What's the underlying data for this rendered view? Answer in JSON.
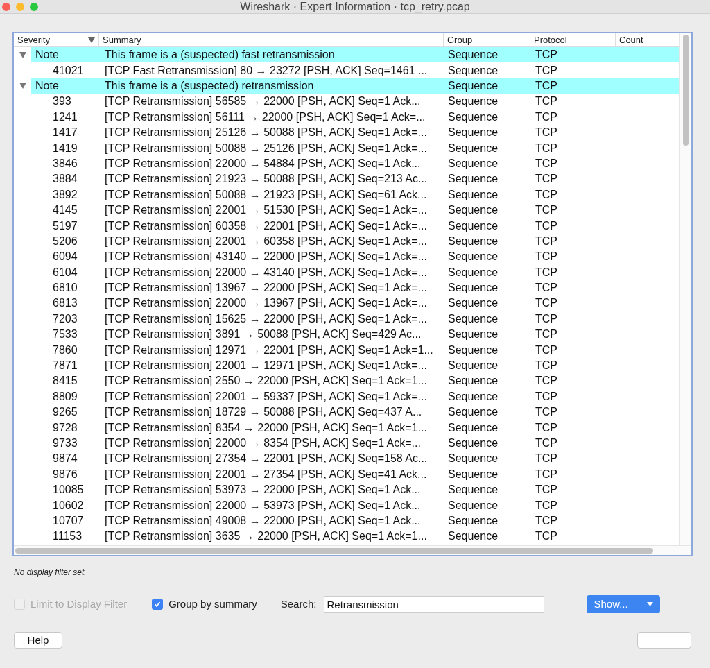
{
  "window": {
    "title": "Wireshark · Expert Information · tcp_retry.pcap"
  },
  "table": {
    "columns": [
      {
        "label": "Severity",
        "sorted": true
      },
      {
        "label": "Summary",
        "sorted": false
      },
      {
        "label": "Group",
        "sorted": false
      },
      {
        "label": "Protocol",
        "sorted": false
      },
      {
        "label": "Count",
        "sorted": false
      }
    ],
    "groups": [
      {
        "severity": "Note",
        "summary": "This frame is a (suspected) fast retransmission",
        "group": "Sequence",
        "protocol": "TCP",
        "expanded": true,
        "children": [
          {
            "packet": "41021",
            "summary": "[TCP Fast Retransmission] 80 → 23272 [PSH, ACK] Seq=1461 ...",
            "group": "Sequence",
            "protocol": "TCP"
          }
        ]
      },
      {
        "severity": "Note",
        "summary": "This frame is a (suspected) retransmission",
        "group": "Sequence",
        "protocol": "TCP",
        "expanded": true,
        "children": [
          {
            "packet": "393",
            "summary": "[TCP Retransmission] 56585 → 22000 [PSH, ACK] Seq=1 Ack...",
            "group": "Sequence",
            "protocol": "TCP"
          },
          {
            "packet": "1241",
            "summary": "[TCP Retransmission] 56111 → 22000 [PSH, ACK] Seq=1 Ack=...",
            "group": "Sequence",
            "protocol": "TCP"
          },
          {
            "packet": "1417",
            "summary": "[TCP Retransmission] 25126 → 50088 [PSH, ACK] Seq=1 Ack=...",
            "group": "Sequence",
            "protocol": "TCP"
          },
          {
            "packet": "1419",
            "summary": "[TCP Retransmission] 50088 → 25126 [PSH, ACK] Seq=1 Ack=...",
            "group": "Sequence",
            "protocol": "TCP"
          },
          {
            "packet": "3846",
            "summary": "[TCP Retransmission] 22000 → 54884 [PSH, ACK] Seq=1 Ack...",
            "group": "Sequence",
            "protocol": "TCP"
          },
          {
            "packet": "3884",
            "summary": "[TCP Retransmission] 21923 → 50088 [PSH, ACK] Seq=213 Ac...",
            "group": "Sequence",
            "protocol": "TCP"
          },
          {
            "packet": "3892",
            "summary": "[TCP Retransmission] 50088 → 21923 [PSH, ACK] Seq=61 Ack...",
            "group": "Sequence",
            "protocol": "TCP"
          },
          {
            "packet": "4145",
            "summary": "[TCP Retransmission] 22001 → 51530 [PSH, ACK] Seq=1 Ack=...",
            "group": "Sequence",
            "protocol": "TCP"
          },
          {
            "packet": "5197",
            "summary": "[TCP Retransmission] 60358 → 22001 [PSH, ACK] Seq=1 Ack=...",
            "group": "Sequence",
            "protocol": "TCP"
          },
          {
            "packet": "5206",
            "summary": "[TCP Retransmission] 22001 → 60358 [PSH, ACK] Seq=1 Ack=...",
            "group": "Sequence",
            "protocol": "TCP"
          },
          {
            "packet": "6094",
            "summary": "[TCP Retransmission] 43140 → 22000 [PSH, ACK] Seq=1 Ack=...",
            "group": "Sequence",
            "protocol": "TCP"
          },
          {
            "packet": "6104",
            "summary": "[TCP Retransmission] 22000 → 43140 [PSH, ACK] Seq=1 Ack=...",
            "group": "Sequence",
            "protocol": "TCP"
          },
          {
            "packet": "6810",
            "summary": "[TCP Retransmission] 13967 → 22000 [PSH, ACK] Seq=1 Ack=...",
            "group": "Sequence",
            "protocol": "TCP"
          },
          {
            "packet": "6813",
            "summary": "[TCP Retransmission] 22000 → 13967 [PSH, ACK] Seq=1 Ack=...",
            "group": "Sequence",
            "protocol": "TCP"
          },
          {
            "packet": "7203",
            "summary": "[TCP Retransmission] 15625 → 22000 [PSH, ACK] Seq=1 Ack=...",
            "group": "Sequence",
            "protocol": "TCP"
          },
          {
            "packet": "7533",
            "summary": "[TCP Retransmission] 3891 → 50088 [PSH, ACK] Seq=429 Ac...",
            "group": "Sequence",
            "protocol": "TCP"
          },
          {
            "packet": "7860",
            "summary": "[TCP Retransmission] 12971 → 22001 [PSH, ACK] Seq=1 Ack=1...",
            "group": "Sequence",
            "protocol": "TCP"
          },
          {
            "packet": "7871",
            "summary": "[TCP Retransmission] 22001 → 12971 [PSH, ACK] Seq=1 Ack=...",
            "group": "Sequence",
            "protocol": "TCP"
          },
          {
            "packet": "8415",
            "summary": "[TCP Retransmission] 2550 → 22000 [PSH, ACK] Seq=1 Ack=1...",
            "group": "Sequence",
            "protocol": "TCP"
          },
          {
            "packet": "8809",
            "summary": "[TCP Retransmission] 22001 → 59337 [PSH, ACK] Seq=1 Ack=...",
            "group": "Sequence",
            "protocol": "TCP"
          },
          {
            "packet": "9265",
            "summary": "[TCP Retransmission] 18729 → 50088 [PSH, ACK] Seq=437 A...",
            "group": "Sequence",
            "protocol": "TCP"
          },
          {
            "packet": "9728",
            "summary": "[TCP Retransmission] 8354 → 22000 [PSH, ACK] Seq=1 Ack=1...",
            "group": "Sequence",
            "protocol": "TCP"
          },
          {
            "packet": "9733",
            "summary": "[TCP Retransmission] 22000 → 8354 [PSH, ACK] Seq=1 Ack=...",
            "group": "Sequence",
            "protocol": "TCP"
          },
          {
            "packet": "9874",
            "summary": "[TCP Retransmission] 27354 → 22001 [PSH, ACK] Seq=158 Ac...",
            "group": "Sequence",
            "protocol": "TCP"
          },
          {
            "packet": "9876",
            "summary": "[TCP Retransmission] 22001 → 27354 [PSH, ACK] Seq=41 Ack...",
            "group": "Sequence",
            "protocol": "TCP"
          },
          {
            "packet": "10085",
            "summary": "[TCP Retransmission] 53973 → 22000 [PSH, ACK] Seq=1 Ack...",
            "group": "Sequence",
            "protocol": "TCP"
          },
          {
            "packet": "10602",
            "summary": "[TCP Retransmission] 22000 → 53973 [PSH, ACK] Seq=1 Ack...",
            "group": "Sequence",
            "protocol": "TCP"
          },
          {
            "packet": "10707",
            "summary": "[TCP Retransmission] 49008 → 22000 [PSH, ACK] Seq=1 Ack...",
            "group": "Sequence",
            "protocol": "TCP"
          },
          {
            "packet": "11153",
            "summary": "[TCP Retransmission] 3635 → 22000 [PSH, ACK] Seq=1 Ack=1...",
            "group": "Sequence",
            "protocol": "TCP"
          }
        ]
      }
    ]
  },
  "status": "No display filter set.",
  "options": [
    {
      "label": "Limit to Display Filter",
      "checked": false,
      "disabled": true
    },
    {
      "label": "Group by summary",
      "checked": true,
      "disabled": false
    }
  ],
  "search": {
    "label": "Search:",
    "value": "Retransmission"
  },
  "show_button": "Show...",
  "help_button": "Help"
}
